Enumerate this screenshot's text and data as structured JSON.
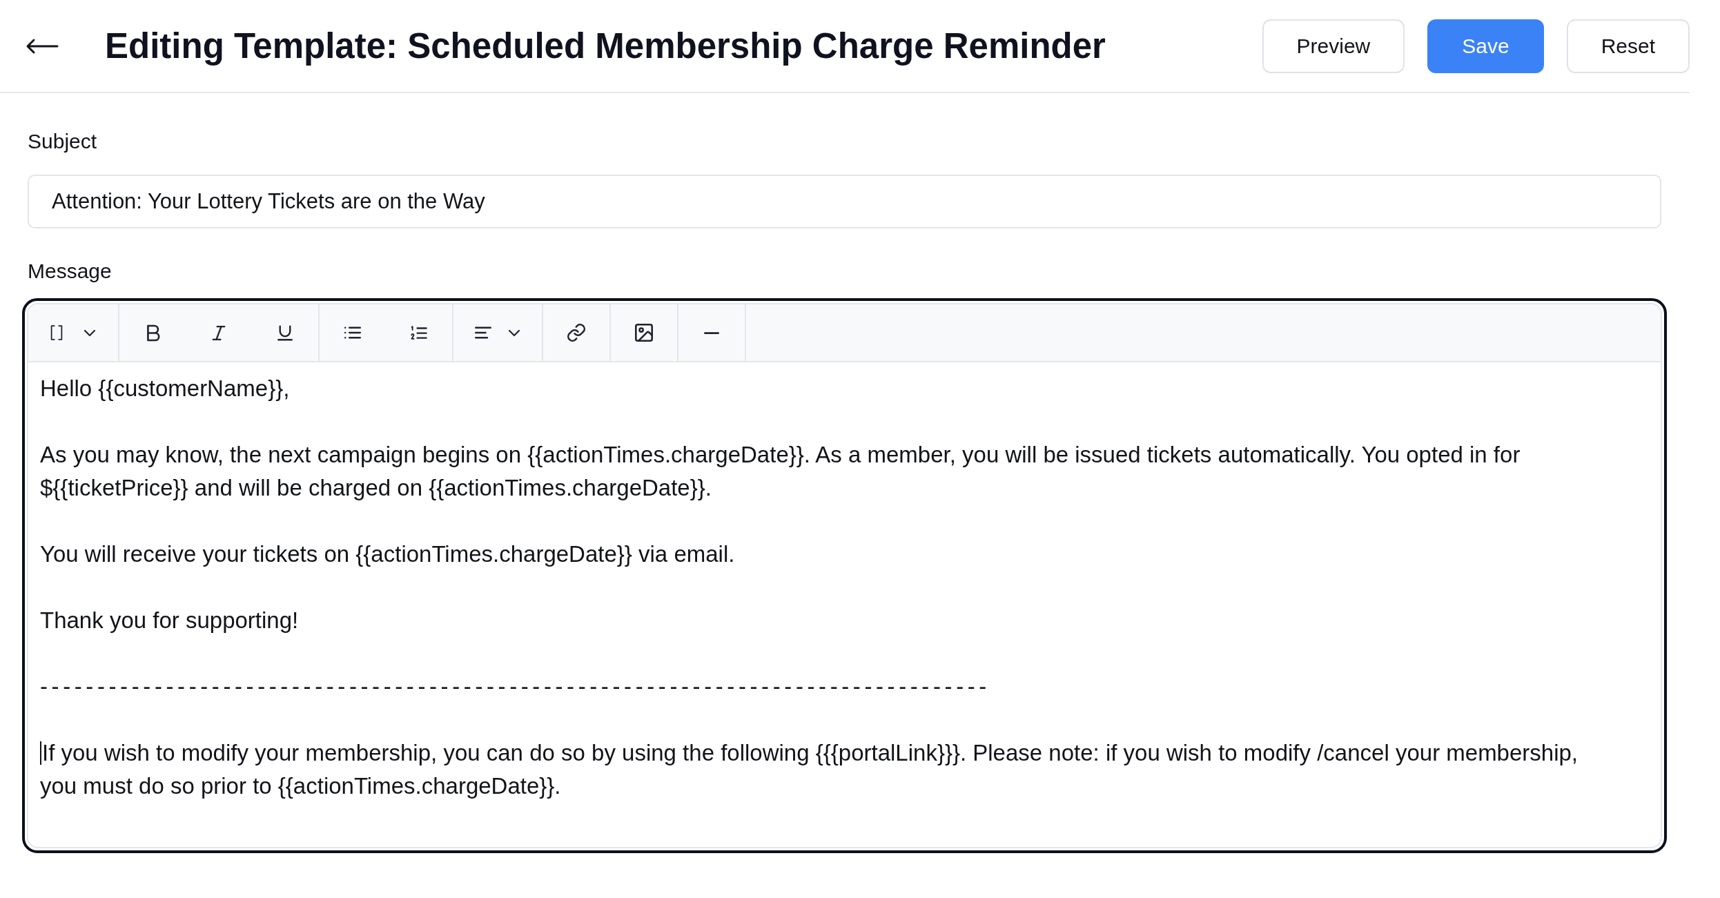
{
  "header": {
    "title": "Editing Template: Scheduled Membership Charge Reminder",
    "actions": [
      {
        "label": "Preview",
        "primary": false
      },
      {
        "label": "Save",
        "primary": true
      },
      {
        "label": "Reset",
        "primary": false
      }
    ]
  },
  "subject": {
    "label": "Subject",
    "value": "Attention: Your Lottery Tickets are on the Way"
  },
  "message": {
    "label": "Message",
    "paragraphs": [
      {
        "kind": "text",
        "text": "Hello {{customerName}},",
        "cursor": false
      },
      {
        "kind": "text",
        "text": "As you may know, the next campaign begins on {{actionTimes.chargeDate}}. As a member, you will be issued tickets automatically. You opted in for ${{ticketPrice}} and will be charged on {{actionTimes.chargeDate}}.",
        "cursor": false
      },
      {
        "kind": "text",
        "text": "You will receive your tickets on {{actionTimes.chargeDate}} via email.",
        "cursor": false
      },
      {
        "kind": "text",
        "text": "Thank you for supporting!",
        "cursor": false
      },
      {
        "kind": "separator",
        "text": "-----------------------------------------------------------------------------------",
        "cursor": false
      },
      {
        "kind": "text",
        "text": "If you wish to modify your membership, you can do so by using the following {{{portalLink}}}. Please note: if you wish to modify /cancel your membership, you must do so prior to {{actionTimes.chargeDate}}.",
        "cursor": true
      }
    ]
  }
}
